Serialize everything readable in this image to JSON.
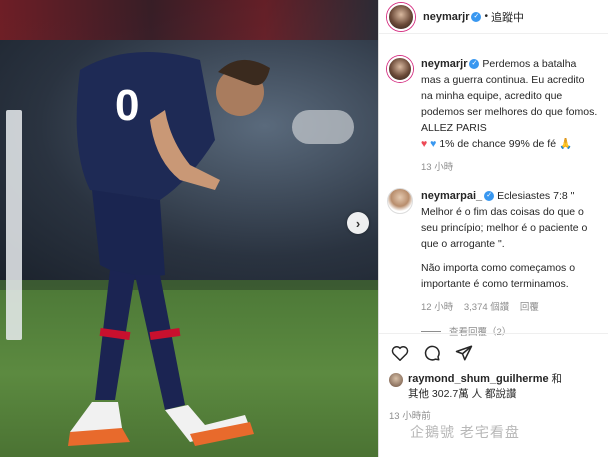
{
  "header": {
    "username": "neymarjr",
    "separator": "•",
    "follow_label": "追蹤中"
  },
  "carousel": {
    "next_icon": "chevron-right-icon",
    "next_glyph": "›"
  },
  "caption": {
    "username": "neymarjr",
    "text": "Perdemos a batalha mas a guerra continua. Eu acredito na minha equipe, acredito que podemos ser melhores do que fomos. ALLEZ PARIS",
    "text_line2": "1% de chance 99% de fé",
    "time": "13 小時"
  },
  "comment": {
    "username": "neymarpai_",
    "text": "Eclesiastes 7:8 \" Melhor é o fim das coisas do que o seu princípio; melhor é o paciente o que o arrogante \".",
    "text2": "Não importa como começamos o importante é como terminamos.",
    "time": "12 小時",
    "likes": "3,374 個讚",
    "reply": "回覆",
    "view_replies": "查看回覆（2）"
  },
  "actions": {
    "like_icon": "heart-icon",
    "comment_icon": "comment-icon",
    "share_icon": "share-icon"
  },
  "likes": {
    "user": "raymond_shum_guilherme",
    "and": "和",
    "others": "其他 302.7萬 人 都說讚"
  },
  "post_time": "13 小時前",
  "watermark": "企鵝號 老宅看盘",
  "colors": {
    "verified": "#3897f0",
    "text": "#262626",
    "muted": "#8e8e8e"
  }
}
